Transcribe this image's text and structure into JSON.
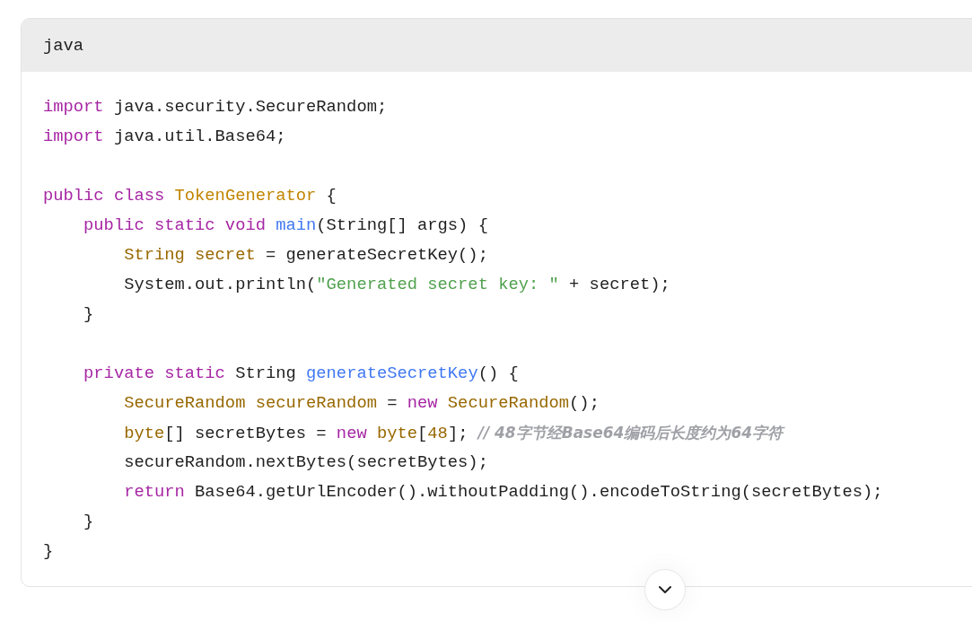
{
  "code_block": {
    "language": "java",
    "lines": [
      {
        "kind": "code",
        "tokens": [
          {
            "kind": "keyword",
            "text": "import"
          },
          {
            "kind": "plain",
            "text": " java.security.SecureRandom;"
          }
        ]
      },
      {
        "kind": "code",
        "tokens": [
          {
            "kind": "keyword",
            "text": "import"
          },
          {
            "kind": "plain",
            "text": " java.util.Base64;"
          }
        ]
      },
      {
        "kind": "blank"
      },
      {
        "kind": "code",
        "tokens": [
          {
            "kind": "keyword",
            "text": "public class "
          },
          {
            "kind": "class",
            "text": "TokenGenerator"
          },
          {
            "kind": "plain",
            "text": " {"
          }
        ]
      },
      {
        "kind": "code",
        "tokens": [
          {
            "kind": "keyword",
            "text": "    public static void "
          },
          {
            "kind": "function",
            "text": "main"
          },
          {
            "kind": "plain",
            "text": "(String[] args) {"
          }
        ]
      },
      {
        "kind": "code",
        "tokens": [
          {
            "kind": "type",
            "text": "        String secret"
          },
          {
            "kind": "plain",
            "text": " = generateSecretKey();"
          }
        ]
      },
      {
        "kind": "code",
        "tokens": [
          {
            "kind": "plain",
            "text": "        System.out.println("
          },
          {
            "kind": "string",
            "text": "\"Generated secret key: \""
          },
          {
            "kind": "plain",
            "text": " + secret);"
          }
        ]
      },
      {
        "kind": "code",
        "tokens": [
          {
            "kind": "plain",
            "text": "    }"
          }
        ]
      },
      {
        "kind": "blank"
      },
      {
        "kind": "code",
        "tokens": [
          {
            "kind": "keyword",
            "text": "    private static"
          },
          {
            "kind": "plain",
            "text": " String "
          },
          {
            "kind": "function",
            "text": "generateSecretKey"
          },
          {
            "kind": "plain",
            "text": "() {"
          }
        ]
      },
      {
        "kind": "code",
        "tokens": [
          {
            "kind": "type",
            "text": "        SecureRandom secureRandom"
          },
          {
            "kind": "plain",
            "text": " = "
          },
          {
            "kind": "keyword",
            "text": "new "
          },
          {
            "kind": "type",
            "text": "SecureRandom"
          },
          {
            "kind": "plain",
            "text": "();"
          }
        ]
      },
      {
        "kind": "code",
        "tokens": [
          {
            "kind": "type",
            "text": "        byte"
          },
          {
            "kind": "plain",
            "text": "[] secretBytes = "
          },
          {
            "kind": "keyword",
            "text": "new "
          },
          {
            "kind": "type",
            "text": "byte"
          },
          {
            "kind": "plain",
            "text": "["
          },
          {
            "kind": "type",
            "text": "48"
          },
          {
            "kind": "plain",
            "text": "]; "
          },
          {
            "kind": "comment",
            "text": "// 48字节经Base64编码后长度约为64字符"
          }
        ]
      },
      {
        "kind": "code",
        "tokens": [
          {
            "kind": "plain",
            "text": "        secureRandom.nextBytes(secretBytes);"
          }
        ]
      },
      {
        "kind": "code",
        "tokens": [
          {
            "kind": "keyword",
            "text": "        return"
          },
          {
            "kind": "plain",
            "text": " Base64.getUrlEncoder().withoutPadding().encodeToString(secretBytes);"
          }
        ]
      },
      {
        "kind": "code",
        "tokens": [
          {
            "kind": "plain",
            "text": "    }"
          }
        ]
      },
      {
        "kind": "code",
        "tokens": [
          {
            "kind": "plain",
            "text": "}"
          }
        ]
      }
    ]
  }
}
